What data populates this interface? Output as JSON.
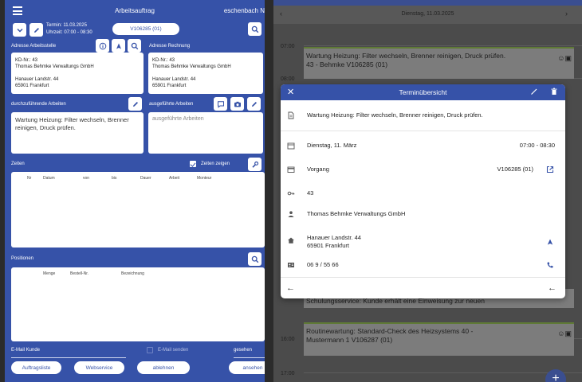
{
  "left": {
    "status_fragment": "",
    "title": "Arbeitsauftrag",
    "user": "eschenbach N",
    "termin": "Termin: 11.03.2025",
    "uhrzeit": "Uhrzeit: 07:00 - 08:30",
    "vorgang_pill": "V106285 (01)",
    "adresse_arbeitsstelle_label": "Adresse Arbeitsstelle",
    "adresse_rechnung_label": "Adresse Rechnung",
    "addr_work": {
      "kd": "KD-Nr.: 43",
      "name": "Thomas Behmke Verwaltungs GmbH",
      "street": "Hanauer Landstr. 44",
      "city": "65901 Frankfurt"
    },
    "addr_bill": {
      "kd": "KD-Nr.: 43",
      "name": "Thomas Behmke Verwaltungs GmbH",
      "street": "Hanauer Landstr. 44",
      "city": "65901 Frankfurt"
    },
    "durchzufuehrende_label": "durchzuführende Arbeiten",
    "ausgefuehrte_label": "ausgeführte Arbeiten",
    "durchzufuehrende_text": "Wartung Heizung: Filter wechseln, Brenner reinigen, Druck prüfen.",
    "ausgefuehrte_placeholder": "ausgeführte Arbeiten",
    "zeiten_label": "Zeiten",
    "zeiten_zeigen_label": "Zeiten zeigen",
    "zeiten_zeigen_checked": true,
    "zeiten_columns": [
      "Nr",
      "Datum",
      "von",
      "bis",
      "Dauer",
      "Arbeit",
      "Monteur"
    ],
    "positionen_label": "Positionen",
    "positionen_columns": [
      "Menge",
      "Bestell-Nr.",
      "Bezeichnung"
    ],
    "email_label": "E-Mail Kunde",
    "email_senden_label": "E-Mail senden",
    "email_senden_checked": false,
    "gesehen_label": "gesehen",
    "btn_auftragsliste": "Auftragsliste",
    "btn_webservice": "Webservice",
    "btn_ablehnen": "ablehnen",
    "btn_ansehen": "ansehen"
  },
  "right": {
    "date": "Dienstag, 11.03.2025",
    "times": [
      "07:00",
      "08:00",
      "16:00",
      "17:00"
    ],
    "events": [
      {
        "line1": "Wartung Heizung: Filter wechseln, Brenner reinigen, Druck prüfen.",
        "line2": "43 - Behmke V106285 (01)"
      },
      {
        "line1": "Schulungsservice: Kunde erhält eine Einweisung zur neuen",
        "line2": ""
      },
      {
        "line1": "Routinewartung: Standard-Check des Heizsystems 40 -",
        "line2": "Mustermann 1 V106287 (01)"
      }
    ],
    "fab_label": "+"
  },
  "modal": {
    "title": "Terminübersicht",
    "description": "Wartung Heizung: Filter wechseln, Brenner reinigen, Druck prüfen.",
    "date": "Dienstag, 11. März",
    "time": "07:00 - 08:30",
    "vorgang_label": "Vorgang",
    "vorgang_value": "V106285 (01)",
    "kdnr": "43",
    "customer": "Thomas Behmke Verwaltungs GmbH",
    "street": "Hanauer Landstr. 44",
    "city": "65901 Frankfurt",
    "phone": "06 9 / 55 66"
  },
  "colors": {
    "primary": "#3652a8",
    "dim_overlay": "#4b4b4b",
    "event_accent": "#5f7a36"
  }
}
